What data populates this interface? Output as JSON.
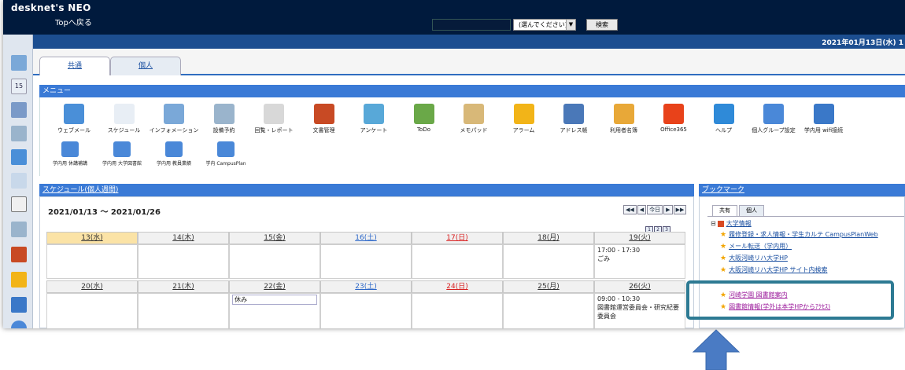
{
  "header": {
    "logo": "desknet's NEO",
    "top_link": "Topへ戻る",
    "search_select": "(選んでください)",
    "search_button": "検索",
    "date": "2021年01月13日(水) 1"
  },
  "tabs": {
    "shared": "共通",
    "personal": "個人"
  },
  "menu": {
    "title": "メニュー",
    "row1": [
      {
        "label": "ウェブメール",
        "icon": "webmail-icon",
        "color": "#4a8fd8"
      },
      {
        "label": "スケジュール",
        "icon": "calendar-icon",
        "color": "#e8eef5"
      },
      {
        "label": "インフォメーション",
        "icon": "information-icon",
        "color": "#7aa8d8"
      },
      {
        "label": "設備予約",
        "icon": "facility-icon",
        "color": "#9ab4cc"
      },
      {
        "label": "回覧・レポート",
        "icon": "report-icon",
        "color": "#d8d8d8"
      },
      {
        "label": "文書管理",
        "icon": "document-icon",
        "color": "#c84a24"
      },
      {
        "label": "アンケート",
        "icon": "survey-icon",
        "color": "#58a8d8"
      },
      {
        "label": "ToDo",
        "icon": "todo-icon",
        "color": "#6aa848"
      },
      {
        "label": "メモパッド",
        "icon": "memopad-icon",
        "color": "#d8b878"
      },
      {
        "label": "アラーム",
        "icon": "alarm-icon",
        "color": "#f2b418"
      },
      {
        "label": "アドレス帳",
        "icon": "address-book-icon",
        "color": "#4a78b8"
      },
      {
        "label": "利用者名簿",
        "icon": "user-list-icon",
        "color": "#e8a838"
      },
      {
        "label": "Office365",
        "icon": "office365-icon",
        "color": "#e8421a"
      },
      {
        "label": "ヘルプ",
        "icon": "help-icon",
        "color": "#2f8ad8"
      },
      {
        "label": "個人グループ設定",
        "icon": "group-settings-icon",
        "color": "#4a88d8"
      },
      {
        "label": "学内用 wifi接続",
        "icon": "wifi-icon",
        "color": "#3a78c8"
      }
    ],
    "row2": [
      {
        "label": "学内用 休講補講",
        "icon": "class-cancel-icon",
        "color": "#4a88d8"
      },
      {
        "label": "学内用 大学図書館",
        "icon": "library-icon",
        "color": "#4a88d8"
      },
      {
        "label": "学内用 教員業績",
        "icon": "research-icon",
        "color": "#4a88d8"
      },
      {
        "label": "学内 CampusPlan",
        "icon": "campusplan-icon",
        "color": "#4a88d8"
      }
    ]
  },
  "schedule": {
    "title": "スケジュール(個人週間)",
    "range": "2021/01/13 ～ 2021/01/26",
    "nav": [
      "◀◀",
      "◀",
      "今日",
      "▶",
      "▶▶"
    ],
    "views": [
      "1",
      "2",
      "3"
    ],
    "week1": [
      {
        "day": "13(水)",
        "color": "#333333",
        "bg": "#fbe3a6",
        "items": []
      },
      {
        "day": "14(木)",
        "color": "#333333",
        "bg": "#f1f1f1",
        "items": []
      },
      {
        "day": "15(金)",
        "color": "#333333",
        "bg": "#f1f1f1",
        "items": []
      },
      {
        "day": "16(土)",
        "color": "#2a66c8",
        "bg": "#f1f1f1",
        "items": []
      },
      {
        "day": "17(日)",
        "color": "#d82020",
        "bg": "#f1f1f1",
        "items": []
      },
      {
        "day": "18(月)",
        "color": "#333333",
        "bg": "#f1f1f1",
        "items": []
      },
      {
        "day": "19(火)",
        "color": "#333333",
        "bg": "#f1f1f1",
        "items": [
          "17:00 - 17:30",
          "ごみ"
        ]
      }
    ],
    "week2": [
      {
        "day": "20(水)",
        "color": "#333333",
        "bg": "#f1f1f1",
        "items": []
      },
      {
        "day": "21(木)",
        "color": "#333333",
        "bg": "#f1f1f1",
        "items": []
      },
      {
        "day": "22(金)",
        "color": "#333333",
        "bg": "#f1f1f1",
        "items": [
          "休み"
        ]
      },
      {
        "day": "23(土)",
        "color": "#2a66c8",
        "bg": "#f1f1f1",
        "items": []
      },
      {
        "day": "24(日)",
        "color": "#d82020",
        "bg": "#f1f1f1",
        "items": []
      },
      {
        "day": "25(月)",
        "color": "#333333",
        "bg": "#f1f1f1",
        "items": []
      },
      {
        "day": "26(火)",
        "color": "#333333",
        "bg": "#f1f1f1",
        "items": [
          "09:00 - 10:30",
          "図書館運営委員会・研究紀要",
          "委員会"
        ]
      }
    ]
  },
  "bookmarks": {
    "title": "ブックマーク",
    "tabs": [
      "共有",
      "個人"
    ],
    "folder": "大学情報",
    "links": [
      {
        "text": "履修登録・求人情報・学生カルテ CampusPlanWeb",
        "color": "#1a4fa0"
      },
      {
        "text": "メール転送（学内用）",
        "color": "#1a4fa0"
      },
      {
        "text": "大阪河崎リハ大学HP",
        "color": "#1a4fa0"
      },
      {
        "text": "大阪河崎リハ大学HP サイト内検索",
        "color": "#1a4fa0"
      },
      {
        "text": "河崎学園 図書館案内",
        "color": "#9b1a9b"
      },
      {
        "text": "図書館情報(学外は本学HPからｱｸｾｽ)",
        "color": "#9b1a9b"
      }
    ]
  },
  "colors": {
    "highlight": "#2d7a93",
    "arrow": "#4a7bc4",
    "accent": "#3a7ad6"
  }
}
